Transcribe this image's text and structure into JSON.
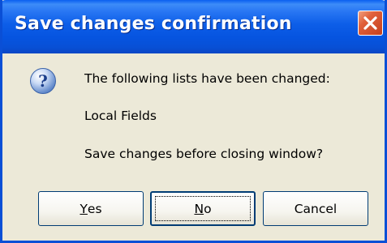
{
  "window": {
    "title": "Save changes confirmation"
  },
  "dialog": {
    "icon": "question-icon",
    "line1": "The following lists have been changed:",
    "line2": "Local Fields",
    "line3": "Save changes before closing window?"
  },
  "buttons": {
    "yes": {
      "accel": "Y",
      "rest": "es"
    },
    "no": {
      "accel": "N",
      "rest": "o"
    },
    "cancel": {
      "label": "Cancel"
    }
  },
  "colors": {
    "titlebar": "#0a5ff0",
    "close": "#e0603a",
    "background": "#ece9d8"
  }
}
